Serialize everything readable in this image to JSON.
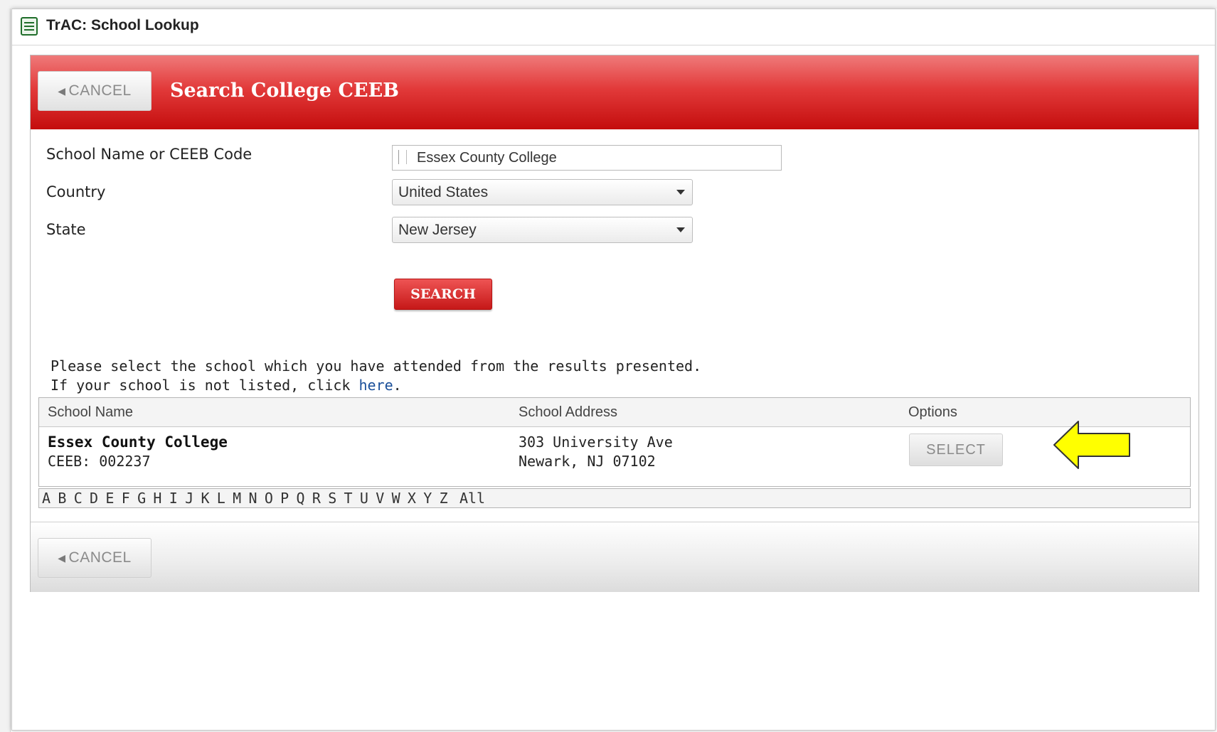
{
  "window": {
    "title": "TrAC: School Lookup"
  },
  "header": {
    "title": "Search College CEEB",
    "cancel_label": "CANCEL"
  },
  "form": {
    "school_label": "School Name or CEEB Code",
    "school_value": "Essex County College",
    "country_label": "Country",
    "country_value": "United States",
    "state_label": "State",
    "state_value": "New Jersey",
    "search_label": "SEARCH"
  },
  "instructions": {
    "line1": "Please select the school which you have attended from the results presented.",
    "line2_prefix": "If your school is not listed, click ",
    "link": "here",
    "line2_suffix": "."
  },
  "results": {
    "columns": [
      "School Name",
      "School Address",
      "Options"
    ],
    "rows": [
      {
        "name": "Essex County College",
        "ceeb": "CEEB: 002237",
        "address_line1": "303 University Ave",
        "address_line2": "Newark, NJ 07102",
        "action": "SELECT"
      }
    ]
  },
  "alphabet": [
    "A",
    "B",
    "C",
    "D",
    "E",
    "F",
    "G",
    "H",
    "I",
    "J",
    "K",
    "L",
    "M",
    "N",
    "O",
    "P",
    "Q",
    "R",
    "S",
    "T",
    "U",
    "V",
    "W",
    "X",
    "Y",
    "Z",
    "All"
  ],
  "footer": {
    "cancel_label": "CANCEL"
  },
  "annotation": {
    "arrow_color": "#ffff00",
    "arrow_icon": "arrow-left-icon"
  },
  "colors": {
    "header_red": "#d21f1f",
    "search_red": "#d42a2a",
    "link_blue": "#1a4f9a"
  }
}
